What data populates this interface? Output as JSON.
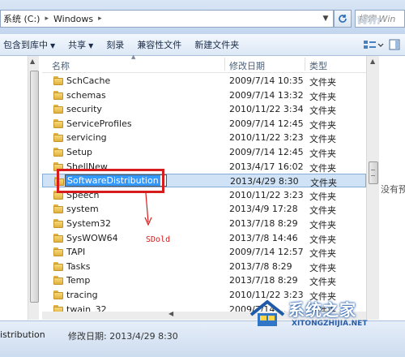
{
  "address": {
    "crumbs": [
      "系统 (C:)",
      "Windows"
    ],
    "search_placeholder": "搜索 Win"
  },
  "toolbar": {
    "items": [
      {
        "label": "包含到库中",
        "dropdown": true
      },
      {
        "label": "共享",
        "dropdown": true
      },
      {
        "label": "刻录",
        "dropdown": false
      },
      {
        "label": "兼容性文件",
        "dropdown": false
      },
      {
        "label": "新建文件夹",
        "dropdown": false
      }
    ]
  },
  "columns": {
    "name": "名称",
    "date": "修改日期",
    "type": "类型"
  },
  "files": [
    {
      "name": "SchCache",
      "date": "2009/7/14 10:35",
      "type": "文件夹"
    },
    {
      "name": "schemas",
      "date": "2009/7/14 13:32",
      "type": "文件夹"
    },
    {
      "name": "security",
      "date": "2010/11/22 3:34",
      "type": "文件夹"
    },
    {
      "name": "ServiceProfiles",
      "date": "2009/7/14 12:45",
      "type": "文件夹"
    },
    {
      "name": "servicing",
      "date": "2010/11/22 3:23",
      "type": "文件夹"
    },
    {
      "name": "Setup",
      "date": "2009/7/14 12:45",
      "type": "文件夹"
    },
    {
      "name": "ShellNew",
      "date": "2013/4/17 16:02",
      "type": "文件夹"
    },
    {
      "name": "SoftwareDistribution",
      "date": "2013/4/29 8:30",
      "type": "文件夹",
      "selected": true,
      "renaming": true
    },
    {
      "name": "Speech",
      "date": "2010/11/22 3:23",
      "type": "文件夹"
    },
    {
      "name": "system",
      "date": "2013/4/9 17:28",
      "type": "文件夹"
    },
    {
      "name": "System32",
      "date": "2013/7/18 8:29",
      "type": "文件夹"
    },
    {
      "name": "SysWOW64",
      "date": "2013/7/8 14:46",
      "type": "文件夹"
    },
    {
      "name": "TAPI",
      "date": "2009/7/14 12:57",
      "type": "文件夹"
    },
    {
      "name": "Tasks",
      "date": "2013/7/8 8:29",
      "type": "文件夹"
    },
    {
      "name": "Temp",
      "date": "2013/7/18 8:29",
      "type": "文件夹"
    },
    {
      "name": "tracing",
      "date": "2010/11/22 3:23",
      "type": "文件夹"
    },
    {
      "name": "twain_32",
      "date": "2009/7/14 ...",
      "type": "文件夹"
    }
  ],
  "annotation": {
    "text": "SDold",
    "color": "#d61c1c"
  },
  "preview": {
    "text": "没有预"
  },
  "status": {
    "name": "istribution",
    "meta": "修改日期: 2013/4/29 8:30"
  },
  "watermark": {
    "title": "系统之家",
    "url": "XITONGZHIJIA.NET",
    "corner": "Win"
  },
  "colors": {
    "selection": "#cfe2f6",
    "rename_highlight": "#3399ff",
    "accent": "#1f5aa8"
  }
}
